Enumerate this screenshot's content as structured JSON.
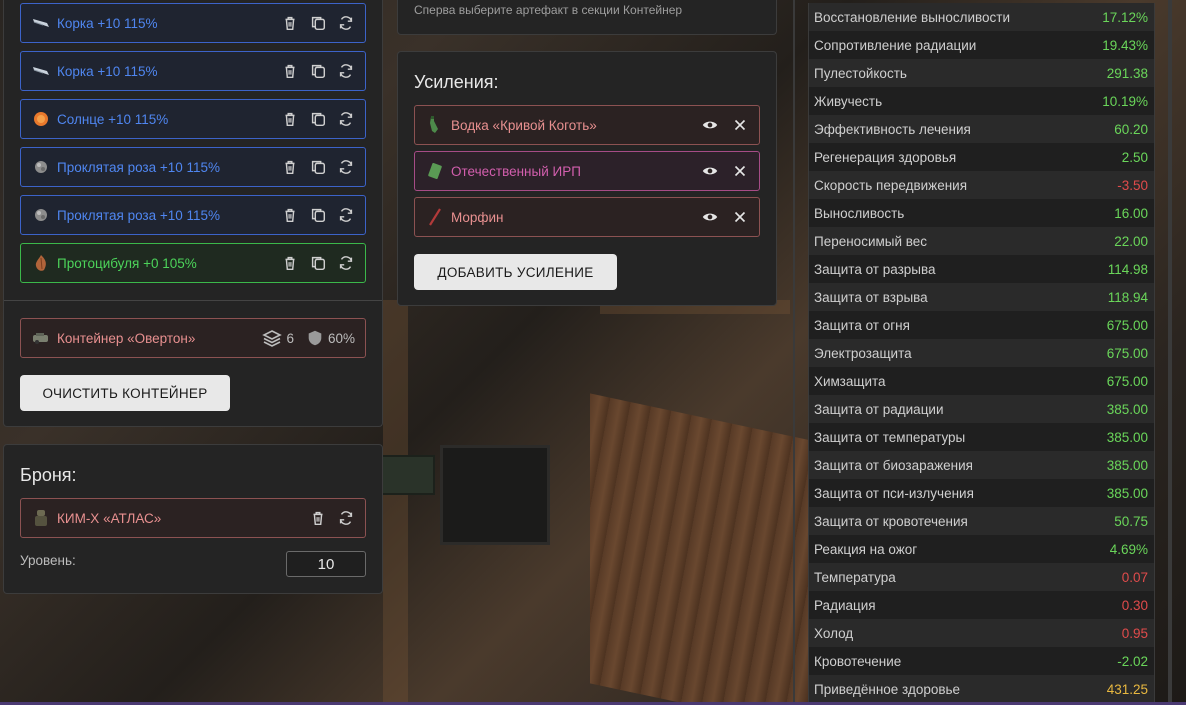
{
  "artifacts": [
    {
      "label": "Корка +10 115%",
      "icon": "knife-shard-icon",
      "rarity": "blue"
    },
    {
      "label": "Корка +10 115%",
      "icon": "knife-shard-icon",
      "rarity": "blue"
    },
    {
      "label": "Солнце +10 115%",
      "icon": "sun-orb-icon",
      "rarity": "blue"
    },
    {
      "label": "Проклятая роза +10 115%",
      "icon": "rose-stone-icon",
      "rarity": "blue"
    },
    {
      "label": "Проклятая роза +10 115%",
      "icon": "rose-stone-icon",
      "rarity": "blue"
    },
    {
      "label": "Протоцибуля +0 105%",
      "icon": "onion-icon",
      "rarity": "green"
    }
  ],
  "container": {
    "label": "Контейнер «Овертон»",
    "slots": "6",
    "protection": "60%",
    "clear_button": "ОЧИСТИТЬ КОНТЕЙНЕР"
  },
  "armor": {
    "title": "Броня:",
    "item": "КИМ-Х «АТЛАС»",
    "level_label": "Уровень:",
    "level_value": "10"
  },
  "hint": "Сперва выберите артефакт в секции Контейнер",
  "boosts": {
    "title": "Усиления:",
    "items": [
      {
        "label": "Водка «Кривой Коготь»",
        "icon": "bottle-icon",
        "color": "red"
      },
      {
        "label": "Отечественный ИРП",
        "icon": "ration-pack-icon",
        "color": "pink"
      },
      {
        "label": "Морфин",
        "icon": "syringe-icon",
        "color": "red"
      }
    ],
    "add_button": "ДОБАВИТЬ УСИЛЕНИЕ"
  },
  "stats": [
    {
      "name": "Восстановление выносливости",
      "value": "17.12%",
      "color": "green"
    },
    {
      "name": "Сопротивление радиации",
      "value": "19.43%",
      "color": "green"
    },
    {
      "name": "Пулестойкость",
      "value": "291.38",
      "color": "green"
    },
    {
      "name": "Живучесть",
      "value": "10.19%",
      "color": "green"
    },
    {
      "name": "Эффективность лечения",
      "value": "60.20",
      "color": "green"
    },
    {
      "name": "Регенерация здоровья",
      "value": "2.50",
      "color": "green"
    },
    {
      "name": "Скорость передвижения",
      "value": "-3.50",
      "color": "red"
    },
    {
      "name": "Выносливость",
      "value": "16.00",
      "color": "green"
    },
    {
      "name": "Переносимый вес",
      "value": "22.00",
      "color": "green"
    },
    {
      "name": "Защита от разрыва",
      "value": "114.98",
      "color": "green"
    },
    {
      "name": "Защита от взрыва",
      "value": "118.94",
      "color": "green"
    },
    {
      "name": "Защита от огня",
      "value": "675.00",
      "color": "green"
    },
    {
      "name": "Электрозащита",
      "value": "675.00",
      "color": "green"
    },
    {
      "name": "Химзащита",
      "value": "675.00",
      "color": "green"
    },
    {
      "name": "Защита от радиации",
      "value": "385.00",
      "color": "green"
    },
    {
      "name": "Защита от температуры",
      "value": "385.00",
      "color": "green"
    },
    {
      "name": "Защита от биозаражения",
      "value": "385.00",
      "color": "green"
    },
    {
      "name": "Защита от пси-излучения",
      "value": "385.00",
      "color": "green"
    },
    {
      "name": "Защита от кровотечения",
      "value": "50.75",
      "color": "green"
    },
    {
      "name": "Реакция на ожог",
      "value": "4.69%",
      "color": "green"
    },
    {
      "name": "Температура",
      "value": "0.07",
      "color": "red"
    },
    {
      "name": "Радиация",
      "value": "0.30",
      "color": "red"
    },
    {
      "name": "Холод",
      "value": "0.95",
      "color": "red"
    },
    {
      "name": "Кровотечение",
      "value": "-2.02",
      "color": "green"
    },
    {
      "name": "Приведённое здоровье",
      "value": "431.25",
      "color": "orange"
    }
  ]
}
